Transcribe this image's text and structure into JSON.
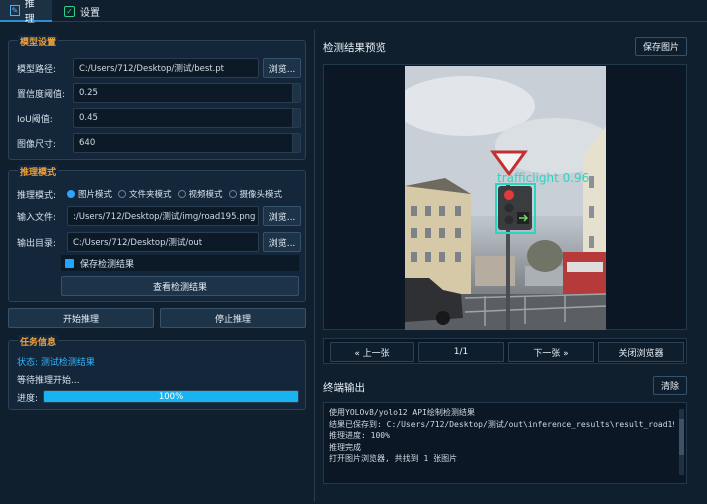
{
  "tabs": [
    {
      "label": "推理",
      "active": true,
      "icon": "chart-edit-icon"
    },
    {
      "label": "设置",
      "active": false,
      "icon": "checkbox-icon"
    }
  ],
  "model": {
    "title": "模型设置",
    "path_label": "模型路径:",
    "path_value": "C:/Users/712/Desktop/测试/best.pt",
    "browse": "浏览...",
    "conf_label": "置信度阈值:",
    "conf_value": "0.25",
    "iou_label": "IoU阈值:",
    "iou_value": "0.45",
    "size_label": "图像尺寸:",
    "size_value": "640"
  },
  "mode": {
    "title": "推理模式",
    "mode_label": "推理模式:",
    "options": [
      "图片模式",
      "文件夹模式",
      "视频模式",
      "摄像头模式"
    ],
    "selected_index": 0,
    "input_label": "输入文件:",
    "input_value": ":/Users/712/Desktop/测试/img/road195.png",
    "input_browse": "浏览...",
    "output_label": "输出目录:",
    "output_value": "C:/Users/712/Desktop/测试/out",
    "output_browse": "浏览...",
    "save_label": "保存检测结果",
    "save_checked": true,
    "view_results": "查看检测结果"
  },
  "actions": {
    "start": "开始推理",
    "stop": "停止推理"
  },
  "task": {
    "title": "任务信息",
    "status": "状态: 测试检测结果",
    "waiting": "等待推理开始...",
    "progress_label": "进度:",
    "progress": 100,
    "progress_text": "100%"
  },
  "preview": {
    "title": "检测结果预览",
    "save_btn": "保存图片",
    "detection_label": "trafficlight 0.96",
    "prev": "« 上一张",
    "page": "1/1",
    "next": "下一张 »",
    "close": "关闭浏览器"
  },
  "terminal": {
    "title": "终端输出",
    "clear": "清除",
    "lines": [
      "使用YOLOv8/yolo12 API绘制检测结果",
      "结果已保存到: C:/Users/712/Desktop/测试/out\\inference_results\\result_road195.png",
      "推理进度: 100%",
      "推理完成",
      "打开图片浏览器, 共找到 1 张图片"
    ]
  },
  "colors": {
    "accent": "#2ea3ff",
    "section_title": "#f0a13c",
    "status_text": "#33b5ff",
    "detect_box": "#2ad6c0"
  }
}
